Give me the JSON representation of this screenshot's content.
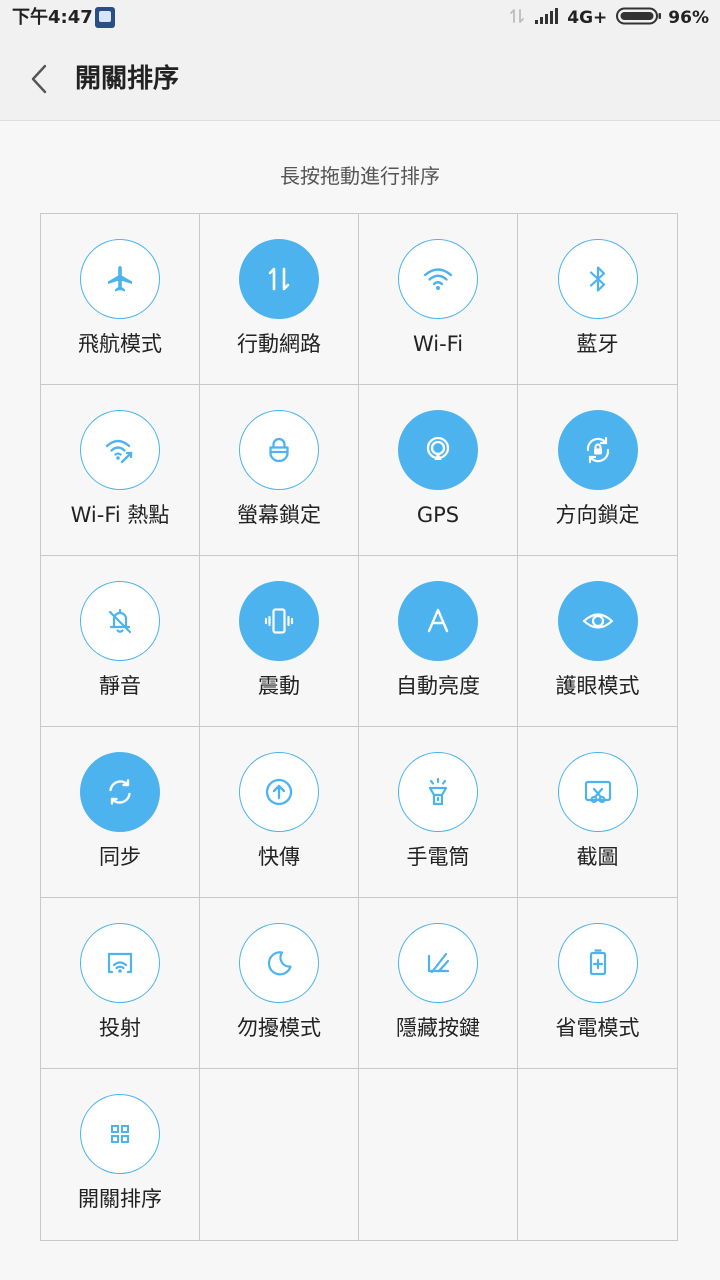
{
  "status_bar": {
    "time": "下午4:47",
    "network": "4G+",
    "battery": "96%"
  },
  "header": {
    "title": "開關排序"
  },
  "hint": "長按拖動進行排序",
  "colors": {
    "accent": "#4db3ee",
    "background": "#f7f7f7",
    "grid_line": "#c9c9c9"
  },
  "toggles": [
    {
      "label": "飛航模式",
      "icon": "airplane-icon",
      "active": false
    },
    {
      "label": "行動網路",
      "icon": "mobile-data-icon",
      "active": true
    },
    {
      "label": "Wi-Fi",
      "icon": "wifi-icon",
      "active": false
    },
    {
      "label": "藍牙",
      "icon": "bluetooth-icon",
      "active": false
    },
    {
      "label": "Wi-Fi 熱點",
      "icon": "hotspot-icon",
      "active": false
    },
    {
      "label": "螢幕鎖定",
      "icon": "lock-icon",
      "active": false
    },
    {
      "label": "GPS",
      "icon": "gps-icon",
      "active": true
    },
    {
      "label": "方向鎖定",
      "icon": "rotation-lock-icon",
      "active": true
    },
    {
      "label": "靜音",
      "icon": "silent-icon",
      "active": false
    },
    {
      "label": "震動",
      "icon": "vibrate-icon",
      "active": true
    },
    {
      "label": "自動亮度",
      "icon": "auto-brightness-icon",
      "active": true
    },
    {
      "label": "護眼模式",
      "icon": "eye-icon",
      "active": true
    },
    {
      "label": "同步",
      "icon": "sync-icon",
      "active": true
    },
    {
      "label": "快傳",
      "icon": "quick-transfer-icon",
      "active": false
    },
    {
      "label": "手電筒",
      "icon": "flashlight-icon",
      "active": false
    },
    {
      "label": "截圖",
      "icon": "screenshot-icon",
      "active": false
    },
    {
      "label": "投射",
      "icon": "cast-icon",
      "active": false
    },
    {
      "label": "勿擾模式",
      "icon": "moon-icon",
      "active": false
    },
    {
      "label": "隱藏按鍵",
      "icon": "hide-keys-icon",
      "active": false
    },
    {
      "label": "省電模式",
      "icon": "battery-saver-icon",
      "active": false
    },
    {
      "label": "開關排序",
      "icon": "grid-icon",
      "active": false
    }
  ]
}
